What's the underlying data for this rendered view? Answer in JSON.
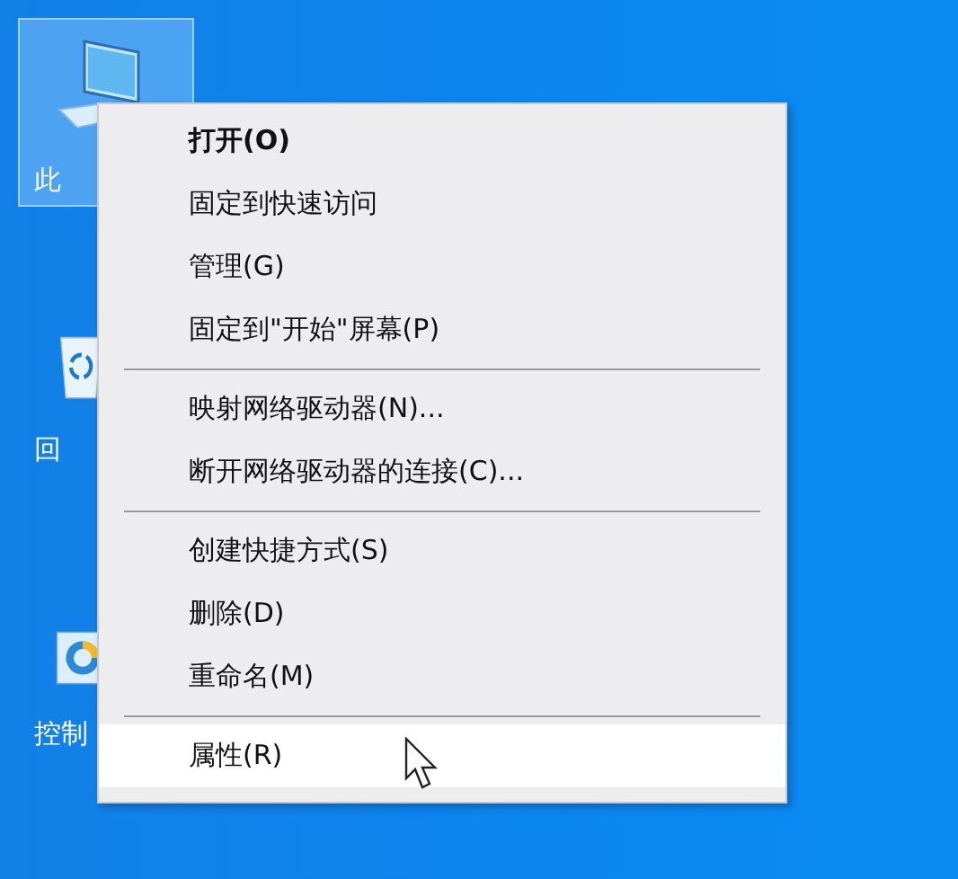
{
  "desktop_icons": [
    {
      "kind": "computer",
      "label": "此",
      "selected": true
    },
    {
      "kind": "recycle",
      "label": "回",
      "selected": false
    },
    {
      "kind": "control",
      "label": "控制",
      "selected": false
    }
  ],
  "context_menu": {
    "items": [
      {
        "kind": "item",
        "label": "打开(O)",
        "bold": true,
        "selected": false
      },
      {
        "kind": "item",
        "label": "固定到快速访问",
        "bold": false,
        "selected": false
      },
      {
        "kind": "item",
        "label": "管理(G)",
        "bold": false,
        "selected": false
      },
      {
        "kind": "item",
        "label": "固定到\"开始\"屏幕(P)",
        "bold": false,
        "selected": false
      },
      {
        "kind": "separator"
      },
      {
        "kind": "item",
        "label": "映射网络驱动器(N)...",
        "bold": false,
        "selected": false
      },
      {
        "kind": "item",
        "label": "断开网络驱动器的连接(C)...",
        "bold": false,
        "selected": false
      },
      {
        "kind": "separator"
      },
      {
        "kind": "item",
        "label": "创建快捷方式(S)",
        "bold": false,
        "selected": false
      },
      {
        "kind": "item",
        "label": "删除(D)",
        "bold": false,
        "selected": false
      },
      {
        "kind": "item",
        "label": "重命名(M)",
        "bold": false,
        "selected": false
      },
      {
        "kind": "separator"
      },
      {
        "kind": "item",
        "label": "属性(R)",
        "bold": false,
        "selected": true
      }
    ]
  }
}
